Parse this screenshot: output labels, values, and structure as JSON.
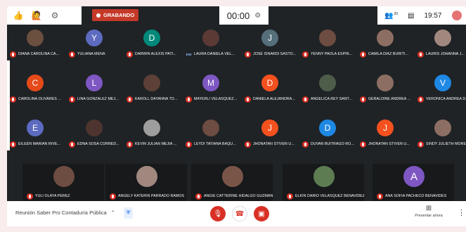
{
  "topbar": {
    "rec_label": "GRABANDO",
    "timer": "00:00",
    "participants_count": "20",
    "clock": "19:57"
  },
  "participants": [
    {
      "name": "DIANA CAROLINA CA...",
      "initial": "",
      "color": "#6b4f3f",
      "mic": "muted"
    },
    {
      "name": "YULIANA MENA",
      "initial": "Y",
      "color": "#5c6bc0",
      "mic": "muted"
    },
    {
      "name": "DARWIN ALEXIS PATI...",
      "initial": "D",
      "color": "#00897b",
      "mic": "muted"
    },
    {
      "name": "LAURA DANIELA VEL...",
      "initial": "",
      "color": "#5b3a36",
      "mic": "speaking"
    },
    {
      "name": "JOSE ISNARDI SASTO...",
      "initial": "J",
      "color": "#546e7a",
      "mic": "muted"
    },
    {
      "name": "YENNY PAOLA ESPIN...",
      "initial": "",
      "color": "#6d4c41",
      "mic": "muted"
    },
    {
      "name": "CAMILA DIAZ BURITI...",
      "initial": "",
      "color": "#8d6e63",
      "mic": "muted"
    },
    {
      "name": "LAURIS JOHANNA J...",
      "initial": "",
      "color": "#a1887f",
      "mic": "muted"
    },
    {
      "name": "CAROLINA OLIVARES ...",
      "initial": "C",
      "color": "#e64a19",
      "mic": "muted"
    },
    {
      "name": "LINA GONZALEZ MEJ...",
      "initial": "L",
      "color": "#7e57c2",
      "mic": "muted"
    },
    {
      "name": "KAROLL DAYANNA TO...",
      "initial": "",
      "color": "#5d4037",
      "mic": "muted"
    },
    {
      "name": "MAYERLI VELASQUEZ...",
      "initial": "M",
      "color": "#7e57c2",
      "mic": "muted"
    },
    {
      "name": "DANIELA ALEJANDRA...",
      "initial": "D",
      "color": "#f4511e",
      "mic": "muted"
    },
    {
      "name": "ANGELICA REY SANT...",
      "initial": "",
      "color": "#4e5d4a",
      "mic": "muted"
    },
    {
      "name": "GERALDINE ANDREA ...",
      "initial": "",
      "color": "#8d6e63",
      "mic": "muted"
    },
    {
      "name": "VERONICA ANDREA D...",
      "initial": "V",
      "color": "#1e88e5",
      "mic": "muted"
    },
    {
      "name": "EILEEN MARIAN RIVE...",
      "initial": "E",
      "color": "#5c6bc0",
      "mic": "muted"
    },
    {
      "name": "EDNA SOSA CORRED...",
      "initial": "",
      "color": "#4e342e",
      "mic": "muted"
    },
    {
      "name": "KEVIN JULIAN MEJIA ...",
      "initial": "",
      "color": "#9e9e9e",
      "mic": "muted"
    },
    {
      "name": "LEYDI TATIANA BAQU...",
      "initial": "",
      "color": "#6d4c41",
      "mic": "muted"
    },
    {
      "name": "JHONATAN STIVEN U...",
      "initial": "J",
      "color": "#f4511e",
      "mic": "muted"
    },
    {
      "name": "DUVAN BUITRAGO RO...",
      "initial": "D",
      "color": "#1e88e5",
      "mic": "muted"
    },
    {
      "name": "JHONATAN STIVEN U...",
      "initial": "J",
      "color": "#f4511e",
      "mic": "muted"
    },
    {
      "name": "SINDY JULIETH MORE...",
      "initial": "",
      "color": "#8d6e63",
      "mic": "muted"
    }
  ],
  "bottom_participants": [
    {
      "name": "YULI OLAYA PEREZ",
      "initial": "",
      "color": "#6d4c41"
    },
    {
      "name": "ANGELY KATERIN PARRADO RAMOS",
      "initial": "",
      "color": "#a1887f"
    },
    {
      "name": "ANGIE CATTERINE HIDALGO GUZMAN",
      "initial": "",
      "color": "#795548"
    },
    {
      "name": "ELKIN DARIO VELASQUEZ BENAVIDEZ",
      "initial": "",
      "color": "#5d7c52"
    },
    {
      "name": "ANA SOFIA PACHECO BENAVIDES",
      "initial": "A",
      "color": "#7e57c2"
    }
  ],
  "bottombar": {
    "meeting_title": "Reunión Saber Pro Contaduría Pública",
    "present_label": "Presentar ahora"
  }
}
